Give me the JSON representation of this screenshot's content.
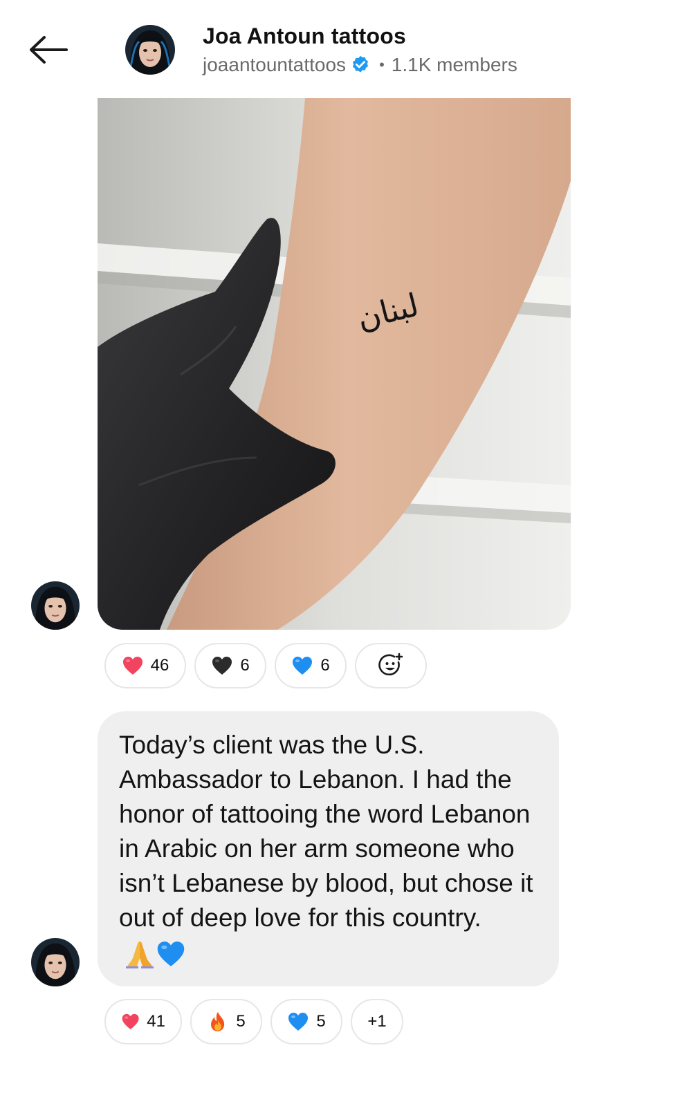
{
  "header": {
    "title": "Joa Antoun tattoos",
    "handle": "joaantountattoos",
    "separator": "•",
    "members": "1.1K members",
    "back_icon": "arrow-left-icon",
    "verified_icon": "verified-badge-icon"
  },
  "post_image": {
    "tattoo_text": "لبنان"
  },
  "reactions_image": [
    {
      "emoji": "red-heart",
      "count": "46"
    },
    {
      "emoji": "black-heart",
      "count": "6"
    },
    {
      "emoji": "blue-heart",
      "count": "6"
    },
    {
      "emoji": "add-reaction-icon"
    }
  ],
  "message": {
    "text": "Today’s client was the U.S. Ambassador to Lebanon. I had the honor of tattooing the word Lebanon in Arabic on her arm someone who isn’t Lebanese by blood, but chose it out of deep love for this country.",
    "emojis": [
      "folded-hands",
      "blue-heart"
    ]
  },
  "reactions_message": [
    {
      "emoji": "red-heart",
      "count": "41"
    },
    {
      "emoji": "fire",
      "count": "5"
    },
    {
      "emoji": "blue-heart",
      "count": "5"
    },
    {
      "more": "+1"
    }
  ],
  "colors": {
    "verified_blue": "#1d9bf0",
    "bubble_bg": "#efefef",
    "pill_border": "#e6e6e6",
    "secondary_text": "#6a6a6a"
  }
}
